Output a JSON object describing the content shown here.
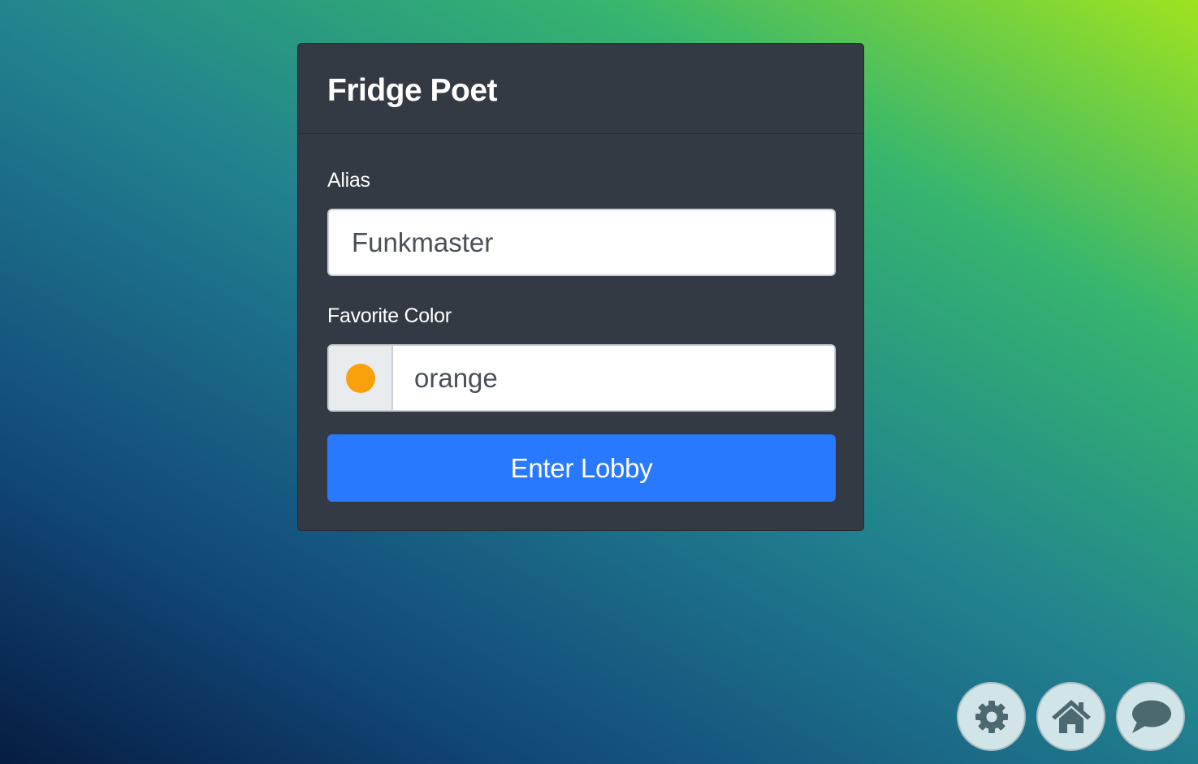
{
  "card": {
    "title": "Fridge Poet"
  },
  "form": {
    "alias_label": "Alias",
    "alias_value": "Funkmaster",
    "color_label": "Favorite Color",
    "color_value": "orange",
    "color_swatch": "#f8a10c",
    "submit_label": "Enter Lobby"
  },
  "colors": {
    "card_background": "#343a43",
    "button_primary": "#2979ff",
    "fab_background": "#d1e4e8",
    "fab_icon": "#4d6970"
  },
  "corner_buttons": [
    {
      "icon": "gear-icon"
    },
    {
      "icon": "home-icon"
    },
    {
      "icon": "chat-bubble-icon"
    }
  ]
}
